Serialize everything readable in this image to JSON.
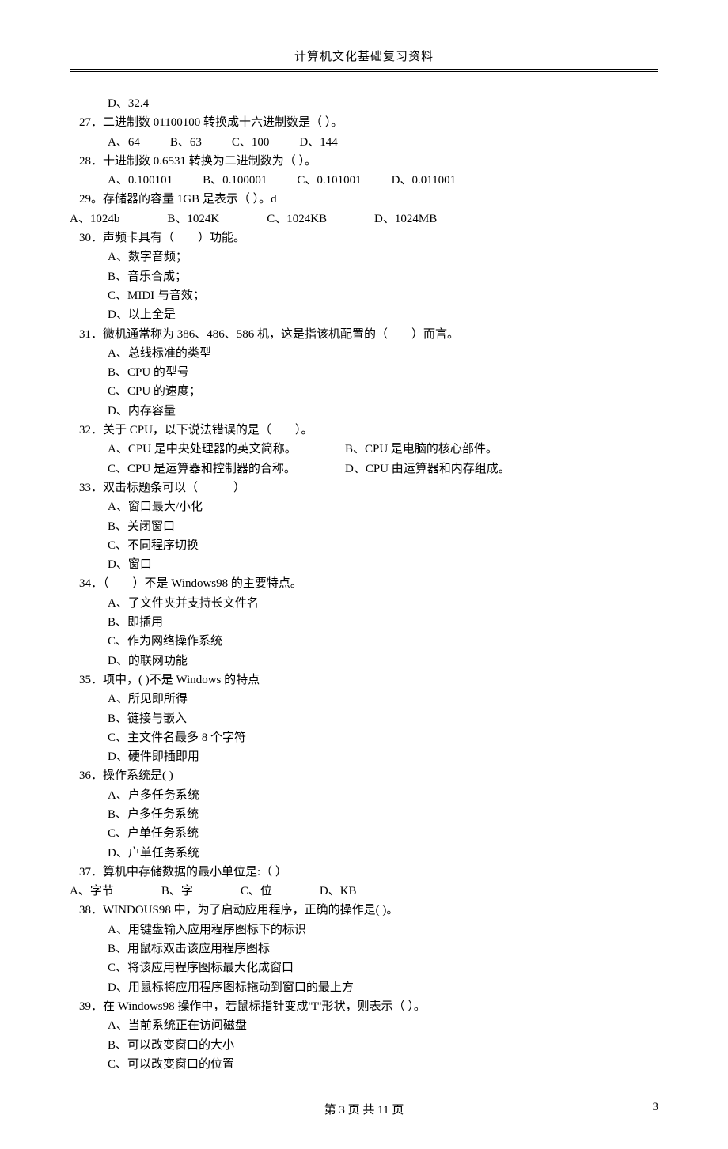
{
  "header": {
    "title": "计算机文化基础复习资料"
  },
  "footer": {
    "center": "第 3 页 共 11 页",
    "right": "3"
  },
  "lead_opt": "D、32.4",
  "questions": [
    {
      "num": "27．",
      "text": "二进制数 01100100 转换成十六进制数是（          ）。",
      "opts_inline": [
        "A、64",
        "B、63",
        "C、100",
        "D、144"
      ],
      "inline_class": "inline-opts"
    },
    {
      "num": "28．",
      "text": "十进制数 0.6531 转换为二进制数为（           ）。",
      "opts_inline": [
        "A、0.100101",
        "B、0.100001",
        "C、0.101001",
        "D、0.011001"
      ],
      "inline_class": "inline-opts"
    },
    {
      "num": "29。",
      "text": "存储器的容量 1GB 是表示（              ）。d",
      "opts_inline": [
        "A、1024b",
        "B、1024K",
        "C、1024KB",
        "D、1024MB"
      ],
      "inline_class": "inline-opts-wide"
    },
    {
      "num": "30．",
      "text": "声频卡具有（　　）功能。",
      "opts_block": [
        "A、数字音频；",
        "B、音乐合成；",
        "C、MIDI 与音效；",
        "D、以上全是"
      ]
    },
    {
      "num": "31．",
      "text": "微机通常称为 386、486、586 机，这是指该机配置的（　　）而言。",
      "opts_block": [
        "A、总线标准的类型",
        "B、CPU 的型号",
        "C、CPU 的速度；",
        "D、内存容量"
      ]
    },
    {
      "num": "32．",
      "text": "关于 CPU，以下说法错误的是（　　）。",
      "opts_pair": [
        {
          "l": "A、CPU 是中央处理器的英文简称。",
          "r": "B、CPU 是电脑的核心部件。"
        },
        {
          "l": "C、CPU 是运算器和控制器的合称。",
          "r": "D、CPU 由运算器和内存组成。"
        }
      ]
    },
    {
      "num": "33．",
      "text": "双击标题条可以（　　　）",
      "opts_block": [
        "A、窗口最大/小化",
        "B、关闭窗口",
        "C、不同程序切换",
        "D、窗口"
      ]
    },
    {
      "num": "34．",
      "text": "（　　）不是 Windows98 的主要特点。",
      "opts_block": [
        "A、了文件夹并支持长文件名",
        "B、即插用",
        "C、作为网络操作系统",
        "D、的联网功能"
      ]
    },
    {
      "num": "35．",
      "text": "项中，(          )不是 Windows 的特点",
      "opts_block": [
        "A、所见即所得",
        "B、链接与嵌入",
        "C、主文件名最多 8 个字符",
        "D、硬件即插即用"
      ]
    },
    {
      "num": "36．",
      "text": "操作系统是(             )",
      "opts_block": [
        "A、户多任务系统",
        "B、户多任务系统",
        "C、户单任务系统",
        "D、户单任务系统"
      ]
    },
    {
      "num": "37．",
      "text": "算机中存储数据的最小单位是:（           ）",
      "opts_inline": [
        "A、字节",
        "B、字",
        "C、位",
        "D、KB"
      ],
      "inline_class": "inline-opts-wide"
    },
    {
      "num": "38．",
      "text": "WINDOUS98 中，为了启动应用程序，正确的操作是(        )。",
      "opts_block": [
        "A、用键盘输入应用程序图标下的标识",
        "B、用鼠标双击该应用程序图标",
        "C、将该应用程序图标最大化成窗口",
        "D、用鼠标将应用程序图标拖动到窗口的最上方"
      ]
    },
    {
      "num": "39．",
      "text": "在 Windows98 操作中，若鼠标指针变成\"I\"形状，则表示（          ）。",
      "opts_block": [
        "A、当前系统正在访问磁盘",
        "B、可以改变窗口的大小",
        "C、可以改变窗口的位置"
      ]
    }
  ]
}
